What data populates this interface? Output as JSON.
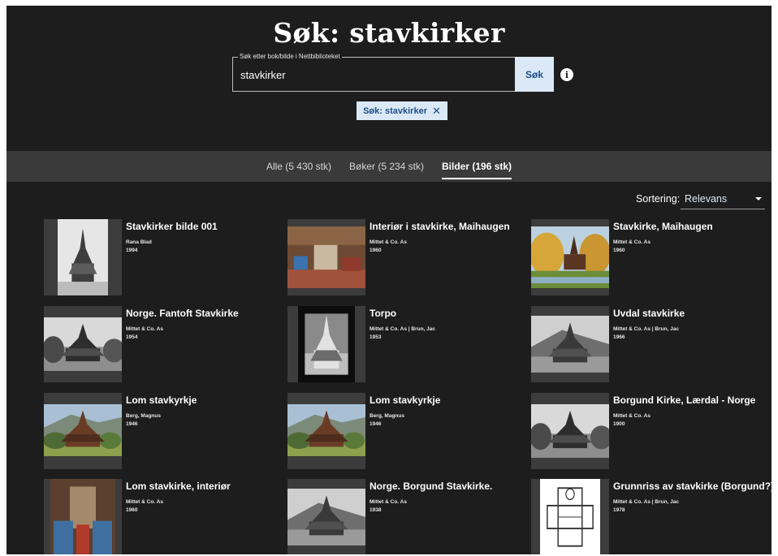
{
  "header": {
    "title": "Søk: stavkirker"
  },
  "search": {
    "legend": "Søk etter bok/bilde i Nettbiblioteket",
    "value": "stavkirker",
    "button_label": "Søk",
    "info_glyph": "i"
  },
  "chip": {
    "label": "Søk: stavkirker",
    "close_glyph": "✕"
  },
  "tabs": [
    {
      "label": "Alle (5 430 stk)"
    },
    {
      "label": "Bøker (5 234 stk)"
    },
    {
      "label": "Bilder (196 stk)",
      "active": true
    }
  ],
  "sort": {
    "label": "Sortering:",
    "value": "Relevans"
  },
  "results": [
    {
      "title": "Stavkirker bilde 001",
      "author": "Rana Blad",
      "year": "1994",
      "thumb": "bw-portrait-light"
    },
    {
      "title": "Interiør i stavkirke, Maihaugen",
      "author": "Mittet & Co. As",
      "year": "1960",
      "thumb": "color-interior"
    },
    {
      "title": "Stavkirke, Maihaugen",
      "author": "Mittet & Co. As",
      "year": "1960",
      "thumb": "color-autumn"
    },
    {
      "title": "Norge. Fantoft Stavkirke",
      "author": "Mittet & Co. As",
      "year": "1954",
      "thumb": "bw-landscape"
    },
    {
      "title": "Torpo",
      "author": "Mittet & Co. As | Brun, Jac",
      "year": "1953",
      "thumb": "bw-portrait-dark"
    },
    {
      "title": "Uvdal stavkirke",
      "author": "Mittet & Co. As | Brun, Jac",
      "year": "1966",
      "thumb": "bw-landscape-dark"
    },
    {
      "title": "Lom stavkyrkje",
      "author": "Berg, Magnus",
      "year": "1946",
      "thumb": "color-landscape"
    },
    {
      "title": "Lom stavkyrkje",
      "author": "Berg, Magnus",
      "year": "1946",
      "thumb": "color-landscape"
    },
    {
      "title": "Borgund Kirke, Lærdal - Norge",
      "author": "Mittet & Co. As",
      "year": "1900",
      "thumb": "bw-landscape"
    },
    {
      "title": "Lom stavkirke, interiør",
      "author": "Mittet & Co. As",
      "year": "1960",
      "thumb": "color-interior-portrait"
    },
    {
      "title": "Norge. Borgund Stavkirke.",
      "author": "Mittet & Co. As",
      "year": "1938",
      "thumb": "bw-landscape-dark"
    },
    {
      "title": "Grunnriss av stavkirke (Borgund?)",
      "author": "Mittet & Co. As | Brun, Jac",
      "year": "1978",
      "thumb": "floorplan"
    }
  ],
  "colors": {
    "background": "#1d1d1d",
    "tabbar": "#3a3a3a",
    "accent_light": "#dbe9f6",
    "accent_text": "#1c4f87"
  }
}
